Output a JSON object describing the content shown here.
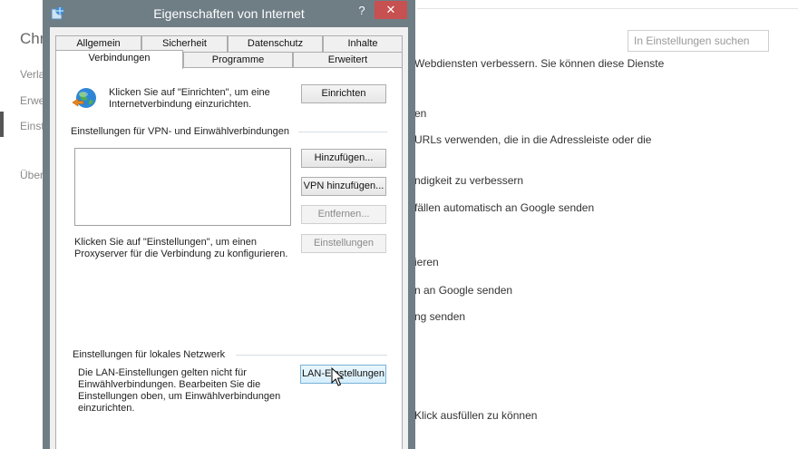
{
  "background": {
    "title": "Chr",
    "nav": [
      "Verla",
      "Erwe",
      "Einst",
      "Über"
    ],
    "search_placeholder": "In Einstellungen suchen",
    "lines": [
      "Webdiensten verbessern. Sie können diese Dienste",
      "en",
      "URLs verwenden, die in die Adressleiste oder die",
      "ndigkeit zu verbessern",
      "fällen automatisch an Google senden",
      "ieren",
      "n an Google senden",
      "ng senden",
      "Klick ausfüllen zu können"
    ]
  },
  "dialog": {
    "title": "Eigenschaften von Internet",
    "help_label": "?",
    "close_label": "✕",
    "tabs_row1": [
      "Allgemein",
      "Sicherheit",
      "Datenschutz",
      "Inhalte"
    ],
    "tabs_row2": [
      "Verbindungen",
      "Programme",
      "Erweitert"
    ],
    "setup_text": "Klicken Sie auf \"Einrichten\", um eine Internetverbindung einzurichten.",
    "setup_button": "Einrichten",
    "vpn_group_label": "Einstellungen für VPN- und Einwählverbindungen",
    "add_button": "Hinzufügen...",
    "add_vpn_button": "VPN hinzufügen...",
    "remove_button": "Entfernen...",
    "settings_button": "Einstellungen",
    "proxy_text": "Klicken Sie auf \"Einstellungen\", um einen Proxyserver für die Verbindung zu konfigurieren.",
    "lan_group_label": "Einstellungen für lokales Netzwerk",
    "lan_text": "Die LAN-Einstellungen gelten nicht für Einwählverbindungen. Bearbeiten Sie die Einstellungen oben, um Einwählverbindungen einzurichten.",
    "lan_button": "LAN-Einstellungen"
  }
}
